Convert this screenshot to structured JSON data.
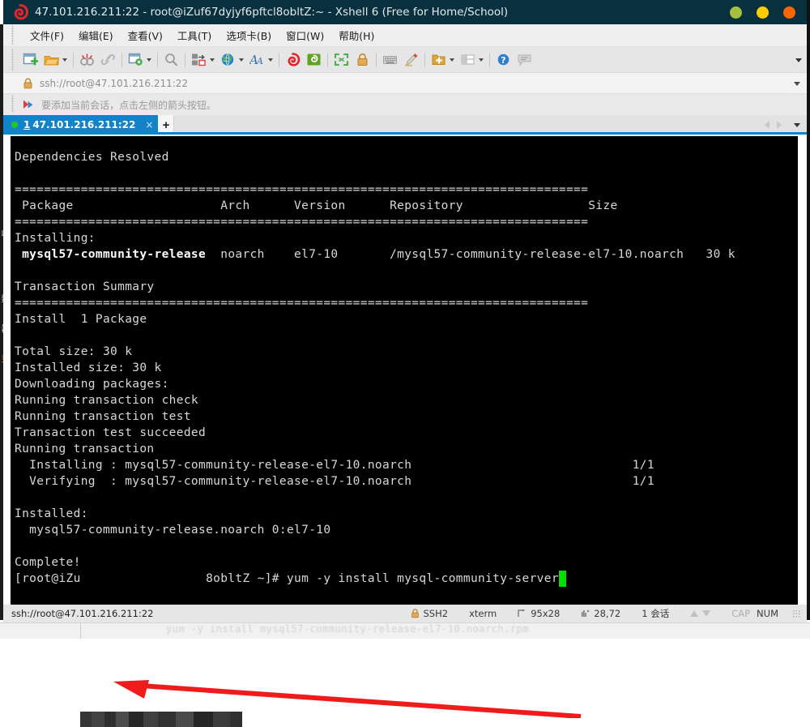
{
  "window": {
    "title": "47.101.216.211:22 - root@iZuf67dyjyf6pftcl8obltZ:~  -  Xshell 6 (Free for Home/School)",
    "logo_icon": "xshell-spiral-logo-icon",
    "controls": [
      {
        "name": "minimize-button",
        "icon": "minimize-dot-icon",
        "color": "#a6bf3f"
      },
      {
        "name": "maximize-button",
        "icon": "maximize-dot-icon",
        "color": "#ffcc00"
      },
      {
        "name": "close-button",
        "icon": "close-dot-icon",
        "color": "#ff6600"
      }
    ]
  },
  "menu": {
    "items": [
      {
        "label": "文件(F)",
        "name": "menu-file"
      },
      {
        "label": "编辑(E)",
        "name": "menu-edit"
      },
      {
        "label": "查看(V)",
        "name": "menu-view"
      },
      {
        "label": "工具(T)",
        "name": "menu-tools"
      },
      {
        "label": "选项卡(B)",
        "name": "menu-tabs"
      },
      {
        "label": "窗口(W)",
        "name": "menu-window"
      },
      {
        "label": "帮助(H)",
        "name": "menu-help"
      }
    ]
  },
  "toolbar": {
    "buttons": [
      {
        "icon": "new-session-icon",
        "caret": false
      },
      {
        "icon": "open-folder-icon",
        "caret": true
      },
      {
        "icon": "disconnect-icon",
        "caret": false
      },
      {
        "icon": "reconnect-link-icon",
        "caret": false
      },
      {
        "icon": "session-properties-icon",
        "caret": true
      },
      {
        "icon": "find-icon",
        "caret": false
      },
      {
        "icon": "layout-arrange-icon",
        "caret": true
      },
      {
        "icon": "globe-encoding-icon",
        "caret": true
      },
      {
        "icon": "font-size-icon",
        "caret": true
      },
      {
        "icon": "xshell-icon",
        "caret": false
      },
      {
        "icon": "xftp-icon",
        "caret": false
      },
      {
        "icon": "fullscreen-icon",
        "caret": false
      },
      {
        "icon": "lock-icon",
        "caret": false
      },
      {
        "icon": "compose-bar-icon",
        "caret": false
      },
      {
        "icon": "highlight-pen-icon",
        "caret": false
      },
      {
        "icon": "new-folder-icon",
        "caret": true
      },
      {
        "icon": "split-view-icon",
        "caret": true
      },
      {
        "icon": "help-icon",
        "caret": false
      },
      {
        "icon": "chat-icon",
        "caret": false
      }
    ],
    "overflow_name": "toolbar-overflow-chevron"
  },
  "address_bar": {
    "lock_icon": "lock-icon",
    "value": "ssh://root@47.101.216.211:22",
    "dropdown_icon": "chevron-down-icon"
  },
  "hint_bar": {
    "icon": "red-blue-arrow-icon",
    "text": "要添加当前会话，点击左侧的箭头按钮。"
  },
  "tabs": {
    "active": {
      "index": "1",
      "label": "47.101.216.211:22",
      "status_dot_color": "#23c723",
      "close_label": "×"
    },
    "new_tab_label": "+",
    "nav_prev_icon": "triangle-left-icon",
    "nav_next_icon": "triangle-right-icon",
    "nav_menu_icon": "chevron-down-icon"
  },
  "terminal": {
    "lines": [
      "Dependencies Resolved",
      "",
      "================================================================================",
      " Package                    Arch      Version      Repository                Size",
      "================================================================================",
      "Installing:",
      " mysql57-community-release  noarch    el7-10       /mysql57-community-release-el7-10.noarch   30 k",
      "",
      "Transaction Summary",
      "================================================================================",
      "Install  1 Package",
      "",
      "Total size: 30 k",
      "Installed size: 30 k",
      "Downloading packages:",
      "Running transaction check",
      "Running transaction test",
      "Transaction test succeeded",
      "Running transaction",
      "  Installing : mysql57-community-release-el7-10.noarch                      1/1",
      "  Verifying  : mysql57-community-release-el7-10.noarch                      1/1",
      "",
      "Installed:",
      "  mysql57-community-release.noarch 0:el7-10",
      "",
      "Complete!"
    ],
    "bold_package_line": "mysql57-community-release",
    "prompt_prefix": "[root@iZu",
    "prompt_suffix": "8obltZ ~]# ",
    "command": "yum -y install mysql-community-server",
    "cursor": "block-cursor",
    "annotation": "red-arrow-pointing-to-installed-package"
  },
  "status_bar": {
    "left_text": "ssh://root@47.101.216.211:22",
    "cells": [
      {
        "name": "protocol",
        "icon": "lock-icon",
        "text": "SSH2"
      },
      {
        "name": "terminal-type",
        "icon": "",
        "text": "xterm"
      },
      {
        "name": "screen-size",
        "icon": "size-icon",
        "text": "95x28"
      },
      {
        "name": "cursor-position",
        "icon": "position-icon",
        "text": "28,72"
      },
      {
        "name": "session-count",
        "icon": "",
        "text": "1 会话"
      }
    ],
    "transfer_up_icon": "arrow-up-icon",
    "transfer_down_icon": "arrow-down-icon",
    "caps_label": "CAP",
    "num_label": "NUM"
  },
  "background_window": {
    "left_strip_chars": [
      "收",
      "数",
      "器",
      "竞"
    ],
    "bottom_text": "yum -y install mysql57-community-release-el7-10.noarch.rpm"
  }
}
